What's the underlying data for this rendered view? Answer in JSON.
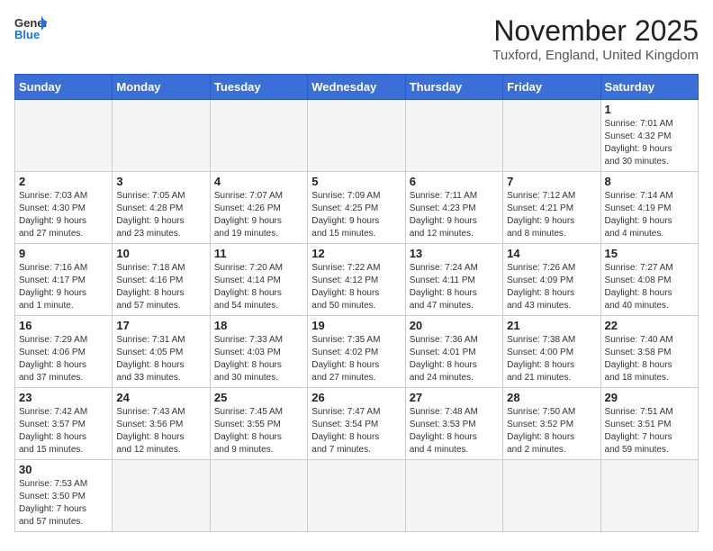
{
  "header": {
    "logo_general": "General",
    "logo_blue": "Blue",
    "title": "November 2025",
    "location": "Tuxford, England, United Kingdom"
  },
  "weekdays": [
    "Sunday",
    "Monday",
    "Tuesday",
    "Wednesday",
    "Thursday",
    "Friday",
    "Saturday"
  ],
  "weeks": [
    [
      {
        "day": "",
        "info": ""
      },
      {
        "day": "",
        "info": ""
      },
      {
        "day": "",
        "info": ""
      },
      {
        "day": "",
        "info": ""
      },
      {
        "day": "",
        "info": ""
      },
      {
        "day": "",
        "info": ""
      },
      {
        "day": "1",
        "info": "Sunrise: 7:01 AM\nSunset: 4:32 PM\nDaylight: 9 hours\nand 30 minutes."
      }
    ],
    [
      {
        "day": "2",
        "info": "Sunrise: 7:03 AM\nSunset: 4:30 PM\nDaylight: 9 hours\nand 27 minutes."
      },
      {
        "day": "3",
        "info": "Sunrise: 7:05 AM\nSunset: 4:28 PM\nDaylight: 9 hours\nand 23 minutes."
      },
      {
        "day": "4",
        "info": "Sunrise: 7:07 AM\nSunset: 4:26 PM\nDaylight: 9 hours\nand 19 minutes."
      },
      {
        "day": "5",
        "info": "Sunrise: 7:09 AM\nSunset: 4:25 PM\nDaylight: 9 hours\nand 15 minutes."
      },
      {
        "day": "6",
        "info": "Sunrise: 7:11 AM\nSunset: 4:23 PM\nDaylight: 9 hours\nand 12 minutes."
      },
      {
        "day": "7",
        "info": "Sunrise: 7:12 AM\nSunset: 4:21 PM\nDaylight: 9 hours\nand 8 minutes."
      },
      {
        "day": "8",
        "info": "Sunrise: 7:14 AM\nSunset: 4:19 PM\nDaylight: 9 hours\nand 4 minutes."
      }
    ],
    [
      {
        "day": "9",
        "info": "Sunrise: 7:16 AM\nSunset: 4:17 PM\nDaylight: 9 hours\nand 1 minute."
      },
      {
        "day": "10",
        "info": "Sunrise: 7:18 AM\nSunset: 4:16 PM\nDaylight: 8 hours\nand 57 minutes."
      },
      {
        "day": "11",
        "info": "Sunrise: 7:20 AM\nSunset: 4:14 PM\nDaylight: 8 hours\nand 54 minutes."
      },
      {
        "day": "12",
        "info": "Sunrise: 7:22 AM\nSunset: 4:12 PM\nDaylight: 8 hours\nand 50 minutes."
      },
      {
        "day": "13",
        "info": "Sunrise: 7:24 AM\nSunset: 4:11 PM\nDaylight: 8 hours\nand 47 minutes."
      },
      {
        "day": "14",
        "info": "Sunrise: 7:26 AM\nSunset: 4:09 PM\nDaylight: 8 hours\nand 43 minutes."
      },
      {
        "day": "15",
        "info": "Sunrise: 7:27 AM\nSunset: 4:08 PM\nDaylight: 8 hours\nand 40 minutes."
      }
    ],
    [
      {
        "day": "16",
        "info": "Sunrise: 7:29 AM\nSunset: 4:06 PM\nDaylight: 8 hours\nand 37 minutes."
      },
      {
        "day": "17",
        "info": "Sunrise: 7:31 AM\nSunset: 4:05 PM\nDaylight: 8 hours\nand 33 minutes."
      },
      {
        "day": "18",
        "info": "Sunrise: 7:33 AM\nSunset: 4:03 PM\nDaylight: 8 hours\nand 30 minutes."
      },
      {
        "day": "19",
        "info": "Sunrise: 7:35 AM\nSunset: 4:02 PM\nDaylight: 8 hours\nand 27 minutes."
      },
      {
        "day": "20",
        "info": "Sunrise: 7:36 AM\nSunset: 4:01 PM\nDaylight: 8 hours\nand 24 minutes."
      },
      {
        "day": "21",
        "info": "Sunrise: 7:38 AM\nSunset: 4:00 PM\nDaylight: 8 hours\nand 21 minutes."
      },
      {
        "day": "22",
        "info": "Sunrise: 7:40 AM\nSunset: 3:58 PM\nDaylight: 8 hours\nand 18 minutes."
      }
    ],
    [
      {
        "day": "23",
        "info": "Sunrise: 7:42 AM\nSunset: 3:57 PM\nDaylight: 8 hours\nand 15 minutes."
      },
      {
        "day": "24",
        "info": "Sunrise: 7:43 AM\nSunset: 3:56 PM\nDaylight: 8 hours\nand 12 minutes."
      },
      {
        "day": "25",
        "info": "Sunrise: 7:45 AM\nSunset: 3:55 PM\nDaylight: 8 hours\nand 9 minutes."
      },
      {
        "day": "26",
        "info": "Sunrise: 7:47 AM\nSunset: 3:54 PM\nDaylight: 8 hours\nand 7 minutes."
      },
      {
        "day": "27",
        "info": "Sunrise: 7:48 AM\nSunset: 3:53 PM\nDaylight: 8 hours\nand 4 minutes."
      },
      {
        "day": "28",
        "info": "Sunrise: 7:50 AM\nSunset: 3:52 PM\nDaylight: 8 hours\nand 2 minutes."
      },
      {
        "day": "29",
        "info": "Sunrise: 7:51 AM\nSunset: 3:51 PM\nDaylight: 7 hours\nand 59 minutes."
      }
    ],
    [
      {
        "day": "30",
        "info": "Sunrise: 7:53 AM\nSunset: 3:50 PM\nDaylight: 7 hours\nand 57 minutes."
      },
      {
        "day": "",
        "info": ""
      },
      {
        "day": "",
        "info": ""
      },
      {
        "day": "",
        "info": ""
      },
      {
        "day": "",
        "info": ""
      },
      {
        "day": "",
        "info": ""
      },
      {
        "day": "",
        "info": ""
      }
    ]
  ]
}
